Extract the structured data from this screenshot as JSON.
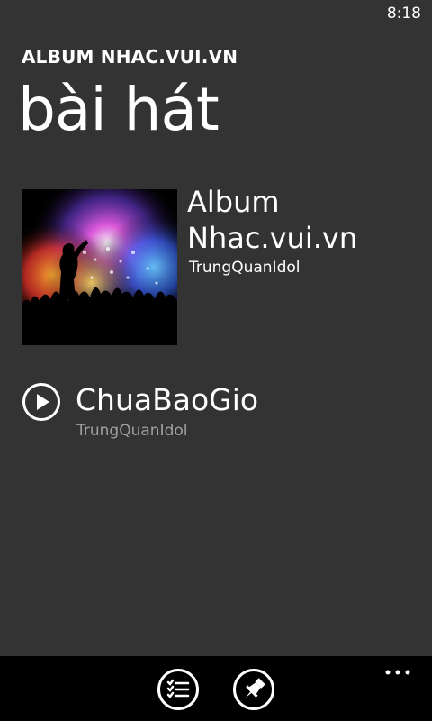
{
  "status_bar": {
    "time": "8:18"
  },
  "header": {
    "app_title": "ALBUM NHAC.VUI.VN",
    "page_title": "bài hát"
  },
  "album": {
    "title": "Album Nhac.vui.vn",
    "artist": "TrungQuanIdol",
    "art_icon": "concert-album-art"
  },
  "songs": [
    {
      "title": "ChuaBaoGio",
      "artist": "TrungQuanIdol",
      "icon": "play-circle-icon"
    }
  ],
  "app_bar": {
    "buttons": [
      {
        "icon": "playlist-icon"
      },
      {
        "icon": "pin-icon"
      }
    ],
    "more_icon": "ellipsis-icon"
  },
  "colors": {
    "background": "#333333",
    "app_bar": "#000000",
    "text_primary": "#ffffff",
    "text_secondary": "#a0a0a0"
  }
}
